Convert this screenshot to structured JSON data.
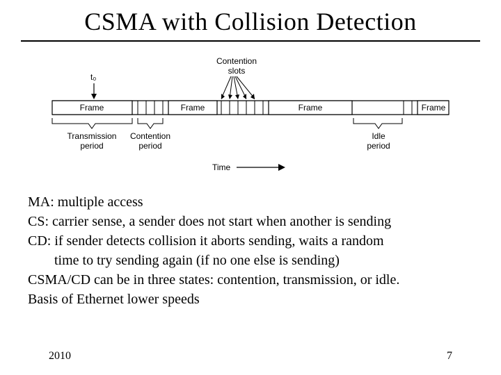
{
  "title": "CSMA with Collision Detection",
  "diagram": {
    "t0": "t₀",
    "contention_slots": "Contention\nslots",
    "frame": "Frame",
    "transmission_period": "Transmission\nperiod",
    "contention_period": "Contention\nperiod",
    "idle_period": "Idle\nperiod",
    "time": "Time"
  },
  "body": {
    "line1": "MA: multiple access",
    "line2": "CS: carrier sense, a sender does not start when another is sending",
    "line3a": "CD: if sender detects collision it aborts sending, waits a random",
    "line3b": "time to try sending again (if no one else is sending)",
    "line4": "CSMA/CD can be in three states: contention, transmission, or idle.",
    "line5": "Basis of Ethernet lower speeds"
  },
  "footer": {
    "year": "2010",
    "page": "7"
  }
}
